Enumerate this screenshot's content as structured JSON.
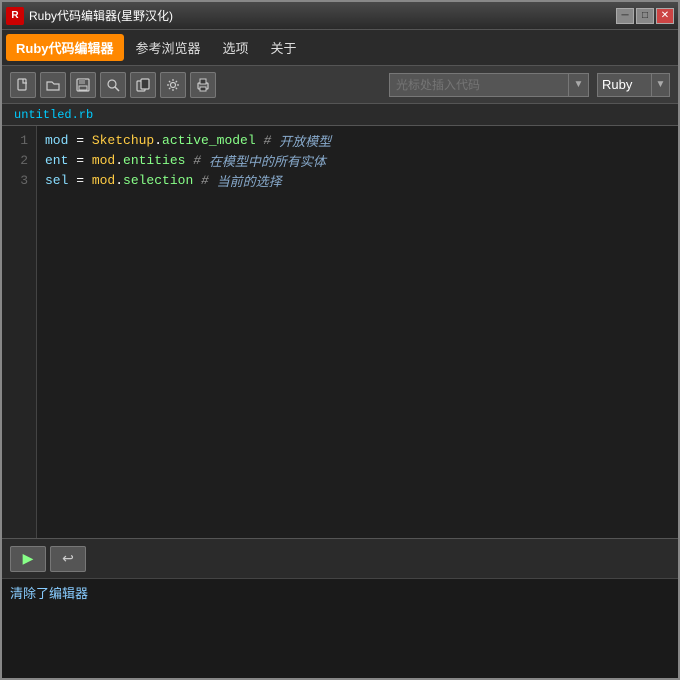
{
  "window": {
    "title": "Ruby代码编辑器(星野汉化)",
    "icon_label": "R"
  },
  "menu": {
    "items": [
      {
        "label": "Ruby代码编辑器",
        "active": true
      },
      {
        "label": "参考浏览器",
        "active": false
      },
      {
        "label": "选项",
        "active": false
      },
      {
        "label": "关于",
        "active": false
      }
    ]
  },
  "toolbar": {
    "search_placeholder": "光标处插入代码",
    "language": "Ruby",
    "buttons": [
      "new",
      "open",
      "save",
      "find",
      "copy",
      "settings",
      "print"
    ]
  },
  "editor": {
    "filename": "untitled.rb",
    "lines": [
      {
        "number": "1",
        "parts": [
          {
            "text": "mod",
            "class": "kw-var"
          },
          {
            "text": " = ",
            "class": "kw-eq"
          },
          {
            "text": "Sketchup",
            "class": "kw-obj"
          },
          {
            "text": ".",
            "class": "kw-eq"
          },
          {
            "text": "active_model",
            "class": "kw-method"
          },
          {
            "text": " # ",
            "class": "kw-comment"
          },
          {
            "text": "开放模型",
            "class": "kw-comment-zh"
          }
        ]
      },
      {
        "number": "2",
        "parts": [
          {
            "text": "ent",
            "class": "kw-var"
          },
          {
            "text": " = ",
            "class": "kw-eq"
          },
          {
            "text": "mod",
            "class": "kw-obj"
          },
          {
            "text": ".",
            "class": "kw-eq"
          },
          {
            "text": "entities",
            "class": "kw-method"
          },
          {
            "text": " # ",
            "class": "kw-comment"
          },
          {
            "text": "在模型中的所有实体",
            "class": "kw-comment-zh"
          }
        ]
      },
      {
        "number": "3",
        "parts": [
          {
            "text": "sel",
            "class": "kw-var"
          },
          {
            "text": " = ",
            "class": "kw-eq"
          },
          {
            "text": "mod",
            "class": "kw-obj"
          },
          {
            "text": ".",
            "class": "kw-eq"
          },
          {
            "text": "selection",
            "class": "kw-method"
          },
          {
            "text": " # ",
            "class": "kw-comment"
          },
          {
            "text": "当前的选择",
            "class": "kw-comment-zh"
          }
        ]
      }
    ]
  },
  "status": {
    "text": "清除了编辑器"
  },
  "controls": {
    "minimize": "─",
    "maximize": "□",
    "close": "✕"
  },
  "icons": {
    "new": "📄",
    "open": "📂",
    "save": "💾",
    "find": "🔍",
    "copy": "📋",
    "settings": "🔧",
    "print": "🖨",
    "run": "▶",
    "back": "↩"
  }
}
